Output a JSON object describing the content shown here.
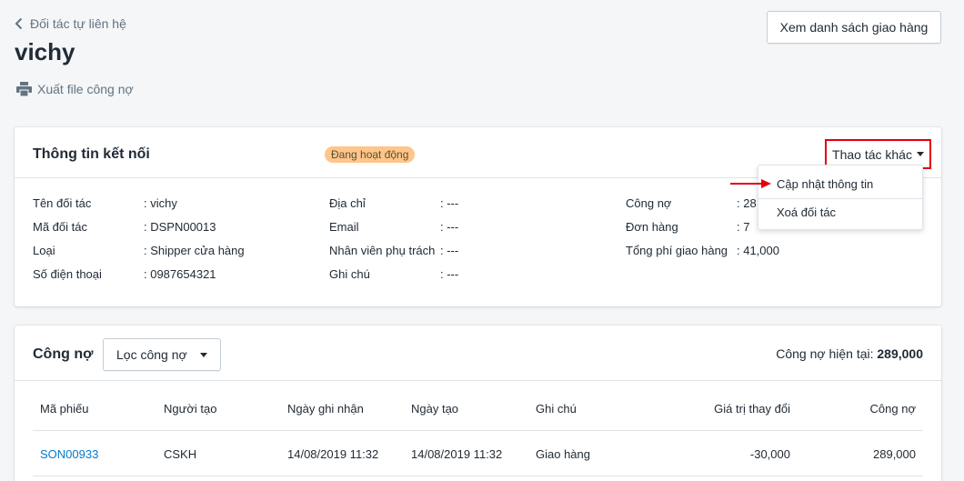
{
  "header": {
    "back_label": "Đối tác tự liên hệ",
    "title": "vichy",
    "export_label": "Xuất file công nợ",
    "view_deliveries_label": "Xem danh sách giao hàng"
  },
  "info_card": {
    "title": "Thông tin kết nối",
    "status_badge": "Đang hoạt động",
    "more_actions_label": "Thao tác khác",
    "col1": [
      {
        "label": "Tên đối tác",
        "value": ": vichy"
      },
      {
        "label": "Mã đối tác",
        "value": ": DSPN00013"
      },
      {
        "label": "Loại",
        "value": ": Shipper cửa hàng"
      },
      {
        "label": "Số điện thoại",
        "value": ": 0987654321"
      }
    ],
    "col2": [
      {
        "label": "Địa chỉ",
        "value": ": ---"
      },
      {
        "label": "Email",
        "value": ": ---"
      },
      {
        "label": "Nhân viên phụ trách",
        "value": ": ---"
      },
      {
        "label": "Ghi chú",
        "value": ": ---"
      }
    ],
    "col3": [
      {
        "label": "Công nợ",
        "value": ": 28"
      },
      {
        "label": "Đơn hàng",
        "value": ": 7"
      },
      {
        "label": "Tổng phí giao hàng",
        "value": ": 41,000"
      }
    ]
  },
  "dropdown": {
    "items": [
      "Cập nhật thông tin",
      "Xoá đối tác"
    ]
  },
  "debt_card": {
    "title": "Công nợ",
    "filter_label": "Lọc công nợ",
    "current_debt_label": "Công nợ hiện tại:",
    "current_debt_value": "289,000",
    "columns": [
      "Mã phiếu",
      "Người tạo",
      "Ngày ghi nhận",
      "Ngày tạo",
      "Ghi chú",
      "Giá trị thay đổi",
      "Công nợ"
    ],
    "rows": [
      [
        "SON00933",
        "CSKH",
        "14/08/2019 11:32",
        "14/08/2019 11:32",
        "Giao hàng",
        "-30,000",
        "289,000"
      ]
    ]
  },
  "colors": {
    "accent_link": "#007ace",
    "badge_bg": "#ffc58b",
    "highlight_red": "#e3000f"
  }
}
